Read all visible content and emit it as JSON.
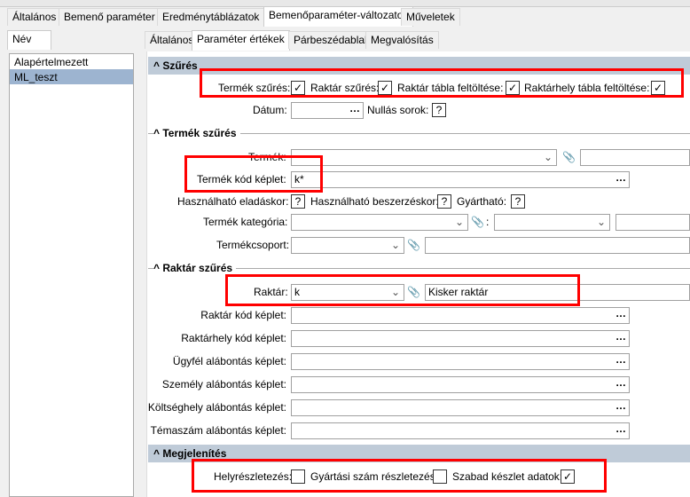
{
  "main_tabs": [
    "Általános",
    "Bemenő paraméter",
    "Eredménytáblázatok",
    "Bemenőparaméter-változatok",
    "Műveletek"
  ],
  "left": {
    "tab": "Név",
    "items": [
      "Alapértelmezett",
      "ML_teszt"
    ]
  },
  "inner_tabs": [
    "Általános",
    "Paraméter értékek",
    "Párbeszédablak",
    "Megvalósítás"
  ],
  "szures": {
    "title": "Szűrés",
    "termek_szures": "Termék szűrés:",
    "raktar_szures": "Raktár szűrés:",
    "raktar_tabla": "Raktár tábla feltöltése:",
    "raktarhely_tabla": "Raktárhely tábla feltöltése:",
    "check": "✓",
    "datum": "Dátum:",
    "nullas": "Nullás sorok:",
    "q": "?"
  },
  "termek": {
    "title": "Termék szűrés",
    "termek": "Termék:",
    "kod_keplet": "Termék kód képlet:",
    "kod_value": "k*",
    "hasznalhato_eladas": "Használható eladáskor:",
    "hasznalhato_beszerzes": "Használható beszerzéskor:",
    "gyarthato": "Gyártható:",
    "kategoria": "Termék kategória:",
    "colon": ":",
    "csoport": "Termékcsoport:"
  },
  "raktar": {
    "title": "Raktár szűrés",
    "raktar": "Raktár:",
    "raktar_value": "k",
    "raktar_name": "Kisker raktár",
    "fields": [
      "Raktár kód képlet:",
      "Raktárhely kód képlet:",
      "Ügyfél alábontás képlet:",
      "Személy alábontás képlet:",
      "Költséghely alábontás képlet:",
      "Témaszám alábontás képlet:"
    ]
  },
  "megjelenites": {
    "title": "Megjelenítés",
    "helyreszletezes": "Helyrészletezés:",
    "gyartasi": "Gyártási szám részletezés:",
    "szabad": "Szabad készlet adatok:"
  },
  "icons": {
    "dots": "…",
    "chevron": "⌄",
    "clip": "📎",
    "caret": "^"
  }
}
